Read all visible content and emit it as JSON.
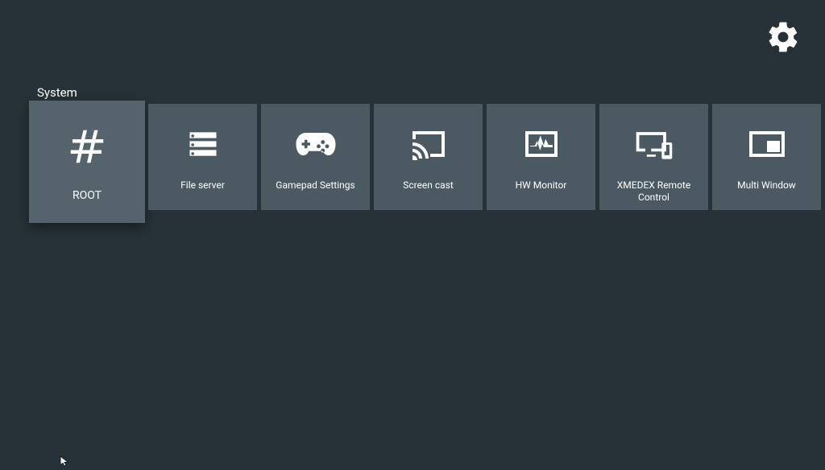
{
  "section_label": "System",
  "settings_icon": "gear-icon",
  "tiles": [
    {
      "id": "root",
      "label": "ROOT",
      "icon": "hash-icon",
      "selected": true
    },
    {
      "id": "file-server",
      "label": "File server",
      "icon": "server-icon",
      "selected": false
    },
    {
      "id": "gamepad",
      "label": "Gamepad Settings",
      "icon": "gamepad-icon",
      "selected": false
    },
    {
      "id": "screen-cast",
      "label": "Screen cast",
      "icon": "cast-icon",
      "selected": false
    },
    {
      "id": "hw-monitor",
      "label": "HW Monitor",
      "icon": "heartbeat-icon",
      "selected": false
    },
    {
      "id": "remote",
      "label": "XMEDEX Remote Control",
      "icon": "remote-icon",
      "selected": false
    },
    {
      "id": "multi-window",
      "label": "Multi Window",
      "icon": "multiwin-icon",
      "selected": false
    }
  ],
  "colors": {
    "bg": "#263238",
    "tile": "#4b5a62",
    "tile_selected": "#55646c",
    "fg": "#ffffff"
  }
}
